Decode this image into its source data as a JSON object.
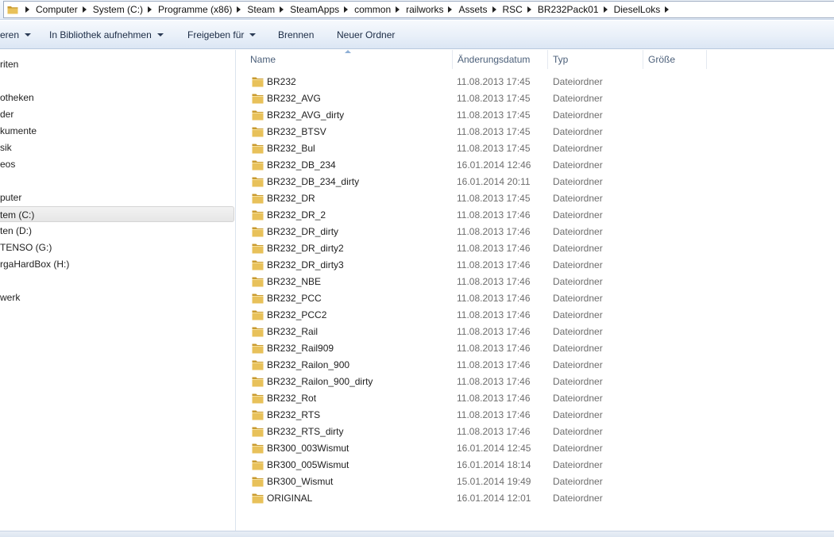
{
  "address_bar": {
    "crumbs": [
      "Computer",
      "System (C:)",
      "Programme (x86)",
      "Steam",
      "SteamApps",
      "common",
      "railworks",
      "Assets",
      "RSC",
      "BR232Pack01",
      "DieselLoks"
    ]
  },
  "toolbar": {
    "organize_label": "eren",
    "library_label": "In Bibliothek aufnehmen",
    "share_label": "Freigeben für",
    "burn_label": "Brennen",
    "new_folder_label": "Neuer Ordner"
  },
  "nav": {
    "favorites": "riten",
    "libraries": "otheken",
    "pictures": "der",
    "documents": "kumente",
    "music": "sik",
    "videos": "eos",
    "computer": "puter",
    "drive_c": "tem (C:)",
    "drive_d": "ten (D:)",
    "drive_g": "TENSO (G:)",
    "drive_h": "rgaHardBox (H:)",
    "network": "werk"
  },
  "columns": {
    "name": "Name",
    "date": "Änderungsdatum",
    "type": "Typ",
    "size": "Größe"
  },
  "files": [
    {
      "name": "BR232",
      "date": "11.08.2013 17:45",
      "type": "Dateiordner"
    },
    {
      "name": "BR232_AVG",
      "date": "11.08.2013 17:45",
      "type": "Dateiordner"
    },
    {
      "name": "BR232_AVG_dirty",
      "date": "11.08.2013 17:45",
      "type": "Dateiordner"
    },
    {
      "name": "BR232_BTSV",
      "date": "11.08.2013 17:45",
      "type": "Dateiordner"
    },
    {
      "name": "BR232_Bul",
      "date": "11.08.2013 17:45",
      "type": "Dateiordner"
    },
    {
      "name": "BR232_DB_234",
      "date": "16.01.2014 12:46",
      "type": "Dateiordner"
    },
    {
      "name": "BR232_DB_234_dirty",
      "date": "16.01.2014 20:11",
      "type": "Dateiordner"
    },
    {
      "name": "BR232_DR",
      "date": "11.08.2013 17:45",
      "type": "Dateiordner"
    },
    {
      "name": "BR232_DR_2",
      "date": "11.08.2013 17:46",
      "type": "Dateiordner"
    },
    {
      "name": "BR232_DR_dirty",
      "date": "11.08.2013 17:46",
      "type": "Dateiordner"
    },
    {
      "name": "BR232_DR_dirty2",
      "date": "11.08.2013 17:46",
      "type": "Dateiordner"
    },
    {
      "name": "BR232_DR_dirty3",
      "date": "11.08.2013 17:46",
      "type": "Dateiordner"
    },
    {
      "name": "BR232_NBE",
      "date": "11.08.2013 17:46",
      "type": "Dateiordner"
    },
    {
      "name": "BR232_PCC",
      "date": "11.08.2013 17:46",
      "type": "Dateiordner"
    },
    {
      "name": "BR232_PCC2",
      "date": "11.08.2013 17:46",
      "type": "Dateiordner"
    },
    {
      "name": "BR232_Rail",
      "date": "11.08.2013 17:46",
      "type": "Dateiordner"
    },
    {
      "name": "BR232_Rail909",
      "date": "11.08.2013 17:46",
      "type": "Dateiordner"
    },
    {
      "name": "BR232_Railon_900",
      "date": "11.08.2013 17:46",
      "type": "Dateiordner"
    },
    {
      "name": "BR232_Railon_900_dirty",
      "date": "11.08.2013 17:46",
      "type": "Dateiordner"
    },
    {
      "name": "BR232_Rot",
      "date": "11.08.2013 17:46",
      "type": "Dateiordner"
    },
    {
      "name": "BR232_RTS",
      "date": "11.08.2013 17:46",
      "type": "Dateiordner"
    },
    {
      "name": "BR232_RTS_dirty",
      "date": "11.08.2013 17:46",
      "type": "Dateiordner"
    },
    {
      "name": "BR300_003Wismut",
      "date": "16.01.2014 12:45",
      "type": "Dateiordner"
    },
    {
      "name": "BR300_005Wismut",
      "date": "16.01.2014 18:14",
      "type": "Dateiordner"
    },
    {
      "name": "BR300_Wismut",
      "date": "15.01.2014 19:49",
      "type": "Dateiordner"
    },
    {
      "name": "ORIGINAL",
      "date": "16.01.2014 12:01",
      "type": "Dateiordner"
    }
  ],
  "icons": {
    "folder": "folder-icon",
    "breadcrumb_separator": "chevron-right-icon",
    "dropdown": "chevron-down-icon"
  },
  "colors": {
    "folder_yellow": "#e8c15a",
    "folder_dark": "#c99a2e",
    "header_text": "#4c607a",
    "meta_text": "#6d6d6d"
  }
}
